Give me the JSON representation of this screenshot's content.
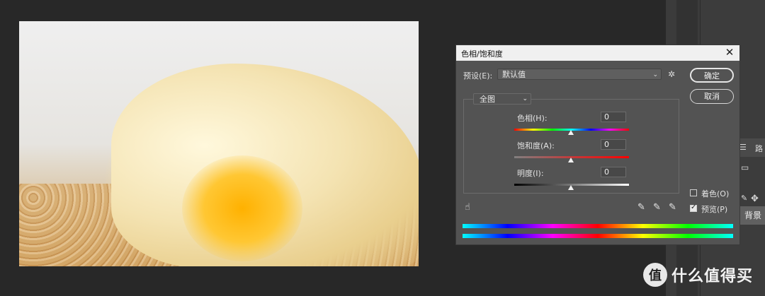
{
  "dialog": {
    "title": "色相/饱和度",
    "preset_label": "预设(E):",
    "preset_value": "默认值",
    "ok_label": "确定",
    "cancel_label": "取消",
    "channel_value": "全图",
    "hue_label": "色相(H):",
    "hue_value": "0",
    "saturation_label": "饱和度(A):",
    "saturation_value": "0",
    "lightness_label": "明度(I):",
    "lightness_value": "0",
    "colorize_label": "着色(O)",
    "colorize_checked": false,
    "preview_label": "预览(P)",
    "preview_checked": true
  },
  "panel": {
    "layer_name": "背景",
    "tab_label": "路"
  },
  "watermark": {
    "logo": "值",
    "text": "什么值得买"
  },
  "icons": [
    "close-icon",
    "chevron-down-icon",
    "gear-icon",
    "hand-target-icon",
    "eyedropper-icon",
    "eyedropper-plus-icon",
    "eyedropper-minus-icon",
    "move-icon",
    "menu-icon"
  ]
}
